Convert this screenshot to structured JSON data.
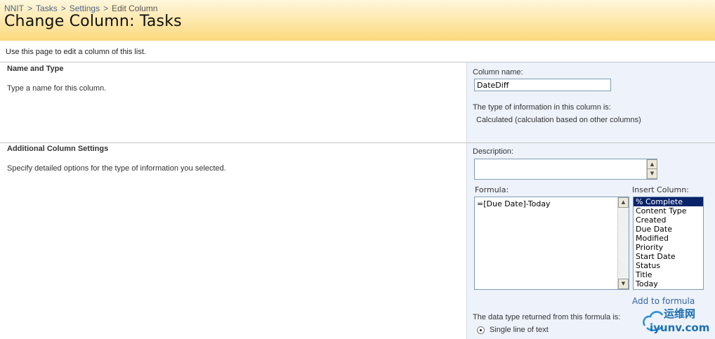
{
  "breadcrumb": {
    "items": [
      "NNIT",
      "Tasks",
      "Settings"
    ],
    "current": "Edit Column",
    "separator": ">"
  },
  "header": {
    "title": "Change Column: Tasks"
  },
  "intro_text": "Use this page to edit a column of this list.",
  "name_type": {
    "title": "Name and Type",
    "description": "Type a name for this column.",
    "column_name_label": "Column name:",
    "column_name_value": "DateDiff",
    "type_label": "The type of information in this column is:",
    "type_value": "Calculated (calculation based on other columns)"
  },
  "additional": {
    "title": "Additional Column Settings",
    "description": "Specify detailed options for the type of information you selected.",
    "description_label": "Description:",
    "description_value": "",
    "formula_label": "Formula:",
    "formula_value": "=[Due Date]-Today",
    "insert_column_label": "Insert Column:",
    "insert_columns": [
      "% Complete",
      "Content Type",
      "Created",
      "Due Date",
      "Modified",
      "Priority",
      "Start Date",
      "Status",
      "Title",
      "Today"
    ],
    "selected_index": 0,
    "add_to_formula": "Add to formula",
    "return_type_label": "The data type returned from this formula is:",
    "return_type_option": "Single line of text"
  },
  "watermark": {
    "text1": "运维网",
    "text2": "iyunv.com"
  },
  "colors": {
    "link": "#4a6687",
    "selection": "#0a246a",
    "panel": "#edf2fb"
  }
}
